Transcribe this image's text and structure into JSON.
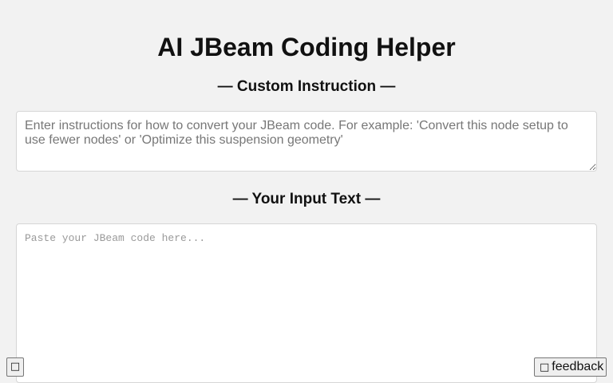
{
  "page": {
    "title": "AI JBeam Coding Helper"
  },
  "custom_instruction": {
    "heading": "— Custom Instruction —",
    "placeholder": "Enter instructions for how to convert your JBeam code. For example: 'Convert this node setup to use fewer nodes' or 'Optimize this suspension geometry'",
    "value": ""
  },
  "input_text": {
    "heading": "— Your Input Text —",
    "placeholder": "Paste your JBeam code here...",
    "value": ""
  },
  "corner_button": {
    "icon": "missing-glyph-icon",
    "glyph": "□"
  },
  "feedback_button": {
    "icon": "missing-glyph-icon",
    "glyph": "□",
    "label": "feedback"
  }
}
